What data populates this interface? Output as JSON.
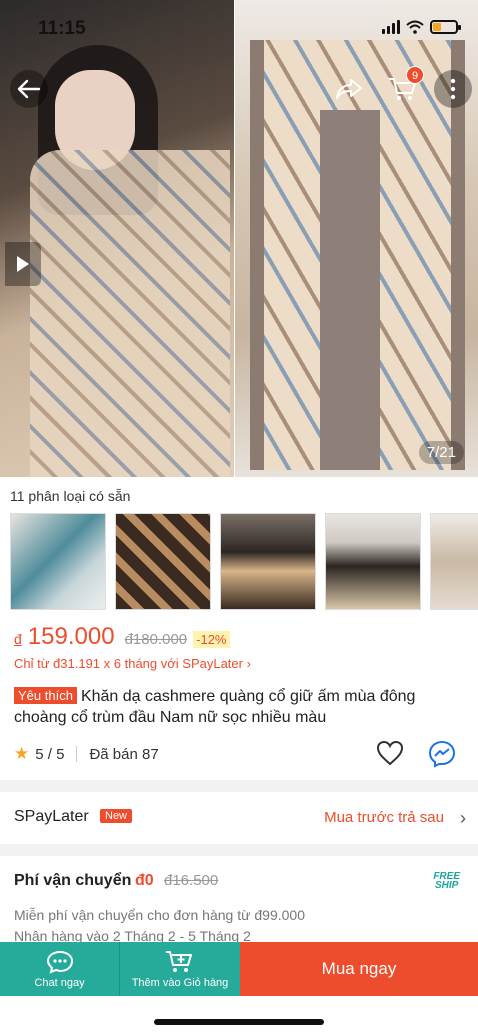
{
  "status_bar": {
    "time": "11:15"
  },
  "header": {
    "cart_count": "9",
    "image_counter": "7/21"
  },
  "colors": {
    "accent": "#ee4d2d",
    "teal": "#26aa99",
    "star": "#f5a623"
  },
  "variants": {
    "label": "11 phân loại có sẵn"
  },
  "price": {
    "currency": "đ",
    "current": "159.000",
    "original": "đ180.000",
    "discount": "-12%",
    "installment": "Chỉ từ đ31.191 x 6 tháng với SPayLater ›"
  },
  "product": {
    "badge": "Yêu thích",
    "title": "Khăn dạ cashmere quàng cổ giữ ấm mùa đông choàng cổ trùm đầu Nam nữ sọc nhiều màu"
  },
  "rating": {
    "score": "5 / 5",
    "sold": "Đã bán 87"
  },
  "spaylater": {
    "label": "SPayLater",
    "badge": "New",
    "action": "Mua trước trả sau"
  },
  "shipping": {
    "title": "Phí vận chuyển",
    "price": "đ0",
    "old_price": "đ16.500",
    "logo_line1": "FREE",
    "logo_line2": "SHIP",
    "line1": "Miễn phí vận chuyển cho đơn hàng từ đ99.000",
    "line2": "Nhận hàng vào 2 Tháng 2 - 5 Tháng 2"
  },
  "bottom_bar": {
    "chat_label": "Chat ngay",
    "cart_label": "Thêm vào Giỏ hàng",
    "buy_label": "Mua ngay"
  }
}
